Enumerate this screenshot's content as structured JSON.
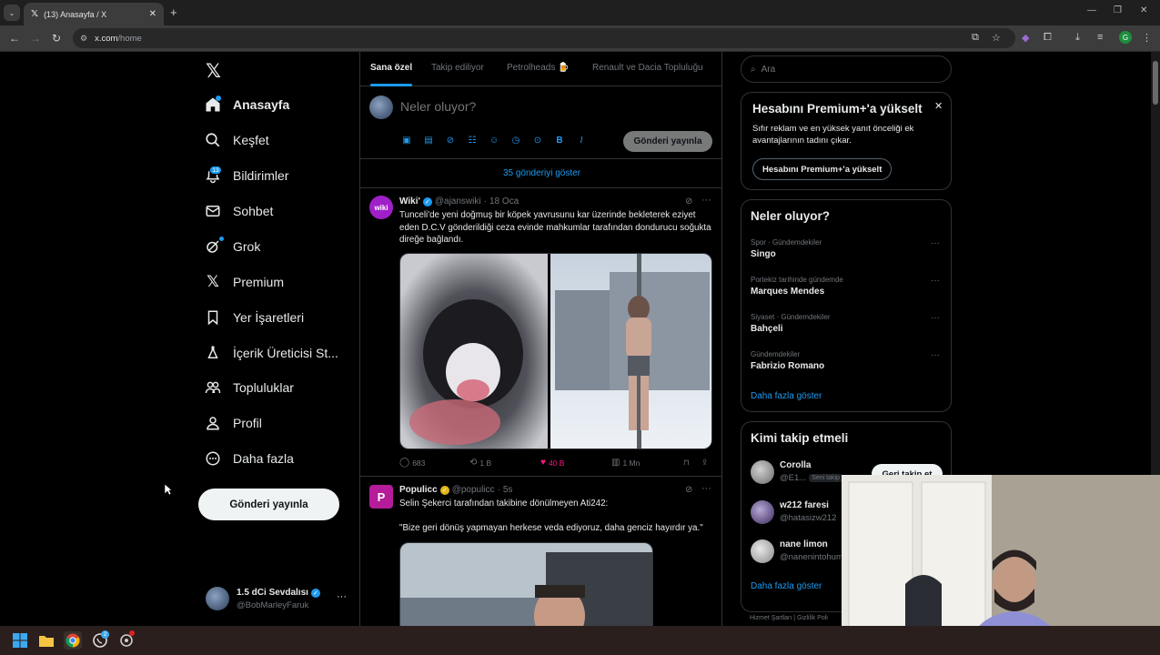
{
  "browser": {
    "tab_title": "(13) Anasayfa / X",
    "url_host": "x.com",
    "url_path": "/home",
    "profile_initial": "G"
  },
  "sidebar": {
    "items": [
      {
        "label": "Anasayfa",
        "icon": "home-icon"
      },
      {
        "label": "Keşfet",
        "icon": "search-icon"
      },
      {
        "label": "Bildirimler",
        "icon": "bell-icon"
      },
      {
        "label": "Sohbet",
        "icon": "mail-icon"
      },
      {
        "label": "Grok",
        "icon": "grok-icon"
      },
      {
        "label": "Premium",
        "icon": "x-icon"
      },
      {
        "label": "Yer İşaretleri",
        "icon": "bookmark-icon"
      },
      {
        "label": "İçerik Üreticisi St...",
        "icon": "flask-icon"
      },
      {
        "label": "Topluluklar",
        "icon": "people-icon"
      },
      {
        "label": "Profil",
        "icon": "person-icon"
      },
      {
        "label": "Daha fazla",
        "icon": "more-circle-icon"
      }
    ],
    "notif_count": "13",
    "post_button": "Gönderi yayınla",
    "account": {
      "name": "1.5 dCi Sevdalısı",
      "handle": "@BobMarleyFaruk",
      "more": "···"
    }
  },
  "feed": {
    "tabs": [
      "Sana özel",
      "Takip ediliyor",
      "Petrolheads 🍺",
      "Renault ve Dacia Topluluğu"
    ],
    "compose_placeholder": "Neler oluyor?",
    "compose_button": "Gönderi yayınla",
    "show_more": "35 gönderiyi göster",
    "posts": [
      {
        "name": "Wiki'",
        "handle": "@ajanswiki",
        "time": "18 Oca",
        "avatar_text": "wiki",
        "text": "Tunceli'de yeni doğmuş bir köpek yavrusunu kar üzerinde bekleterek eziyet eden D.C.V gönderildiği ceza evinde mahkumlar tarafından dondurucu soğukta direğe bağlandı.",
        "replies": "683",
        "reposts": "1 B",
        "likes": "40 B",
        "views": "1 Mn"
      },
      {
        "name": "Populicc",
        "handle": "@populicc",
        "time": "5s",
        "avatar_text": "P",
        "text1": "Selin Şekerci tarafından takibine dönülmeyen Ati242:",
        "text2": "\"Bize geri dönüş yapmayan herkese veda ediyoruz, daha genciz hayırdır ya.\""
      }
    ]
  },
  "right": {
    "search_placeholder": "Ara",
    "premium": {
      "title": "Hesabını Premium+'a yükselt",
      "desc": "Sıfır reklam ve en yüksek yanıt önceliği ek avantajlarının tadını çıkar.",
      "button": "Hesabını Premium+'a yükselt"
    },
    "trends": {
      "title": "Neler oluyor?",
      "items": [
        {
          "context": "Spor · Gündemdekiler",
          "name": "Singo"
        },
        {
          "context": "Portekiz tarihinde gündemde",
          "name": "Marques Mendes"
        },
        {
          "context": "Siyaset · Gündemdekiler",
          "name": "Bahçeli"
        },
        {
          "context": "Gündemdekiler",
          "name": "Fabrizio Romano"
        }
      ],
      "more": "Daha fazla göster"
    },
    "who_to_follow": {
      "title": "Kimi takip etmeli",
      "users": [
        {
          "name": "Corolla",
          "handle": "@E1...",
          "badge": "Seni takip"
        },
        {
          "name": "w212 faresi",
          "handle": "@hatasizw212"
        },
        {
          "name": "nane limon",
          "handle": "@nanenintohum"
        }
      ],
      "follow_back": "Geri takip et",
      "more": "Daha fazla göster"
    },
    "footer": "Hizmet Şartları  |  Gizlilik Poli"
  },
  "colors": {
    "accent": "#1d9bf0",
    "like": "#f91880",
    "bg": "#000000",
    "border": "#2f3336",
    "muted": "#71767b"
  }
}
